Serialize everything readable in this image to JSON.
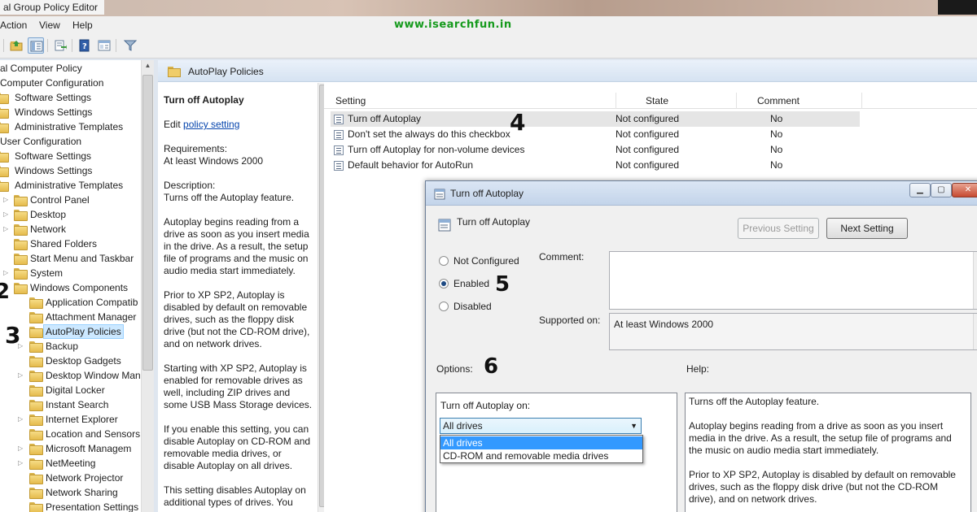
{
  "window": {
    "title": "al Group Policy Editor"
  },
  "menu": {
    "items": [
      "Action",
      "View",
      "Help"
    ],
    "brand": "www.isearchfun.in"
  },
  "toolbar": {
    "icons": [
      "back-folder-icon",
      "show-hide-tree-icon",
      "export-list-icon",
      "help-icon",
      "properties-icon",
      "filter-icon"
    ]
  },
  "tree": {
    "items": [
      "al Computer Policy",
      "Computer Configuration",
      "Software Settings",
      "Windows Settings",
      "Administrative Templates",
      "User Configuration",
      "Software Settings",
      "Windows Settings",
      "Administrative Templates",
      "Control Panel",
      "Desktop",
      "Network",
      "Shared Folders",
      "Start Menu and Taskbar",
      "System",
      "Windows Components",
      "Application Compatib",
      "Attachment Manager",
      "AutoPlay Policies",
      "Backup",
      "Desktop Gadgets",
      "Desktop Window Man",
      "Digital Locker",
      "Instant Search",
      "Internet Explorer",
      "Location and Sensors",
      "Microsoft Managem",
      "NetMeeting",
      "Network Projector",
      "Network Sharing",
      "Presentation Settings"
    ],
    "selected": "AutoPlay Policies"
  },
  "details": {
    "header": "AutoPlay Policies",
    "description": {
      "title": "Turn off Autoplay",
      "edit_prefix": "Edit",
      "edit_link": "policy setting",
      "requirements_label": "Requirements:",
      "requirements": "At least Windows 2000",
      "description_label": "Description:",
      "description": "Turns off the Autoplay feature.",
      "p1": "Autoplay begins reading from a drive as soon as you insert media in the drive. As a result, the setup file of programs and the music on audio media start immediately.",
      "p2": "Prior to XP SP2, Autoplay is disabled by default on removable drives, such as the floppy disk drive (but not the CD-ROM drive), and on network drives.",
      "p3": "Starting with XP SP2, Autoplay is enabled for removable drives as well, including ZIP drives and some USB Mass Storage devices.",
      "p4": "If you enable this setting, you can disable Autoplay on CD-ROM and removable media drives, or disable Autoplay on all drives.",
      "p5": "This setting disables Autoplay on additional types of drives. You"
    },
    "columns": {
      "setting": "Setting",
      "state": "State",
      "comment": "Comment"
    },
    "rows": [
      {
        "setting": "Turn off Autoplay",
        "state": "Not configured",
        "comment": "No"
      },
      {
        "setting": "Don't set the always do this checkbox",
        "state": "Not configured",
        "comment": "No"
      },
      {
        "setting": "Turn off Autoplay for non-volume devices",
        "state": "Not configured",
        "comment": "No"
      },
      {
        "setting": "Default behavior for AutoRun",
        "state": "Not configured",
        "comment": "No"
      }
    ]
  },
  "dialog": {
    "title": "Turn off Autoplay",
    "heading": "Turn off Autoplay",
    "prev_button": "Previous Setting",
    "next_button": "Next Setting",
    "radios": [
      "Not Configured",
      "Enabled",
      "Disabled"
    ],
    "selected_radio": "Enabled",
    "comment_label": "Comment:",
    "supported_label": "Supported on:",
    "supported_value": "At least Windows 2000",
    "options_label": "Options:",
    "help_label": "Help:",
    "option_label": "Turn off Autoplay on:",
    "combo_value": "All drives",
    "dropdown_options": [
      "All drives",
      "CD-ROM and removable media drives"
    ],
    "help": {
      "p1": "Turns off the Autoplay feature.",
      "p2": "Autoplay begins reading from a drive as soon as you insert media in the drive. As a result, the setup file of programs and the music on audio media start immediately.",
      "p3": "Prior to XP SP2, Autoplay is disabled by default on removable drives, such as the floppy disk drive (but not the CD-ROM drive), and on network drives."
    }
  },
  "annotations": {
    "n2": "2",
    "n3": "3",
    "n4": "4",
    "n5": "5",
    "n6": "6"
  }
}
